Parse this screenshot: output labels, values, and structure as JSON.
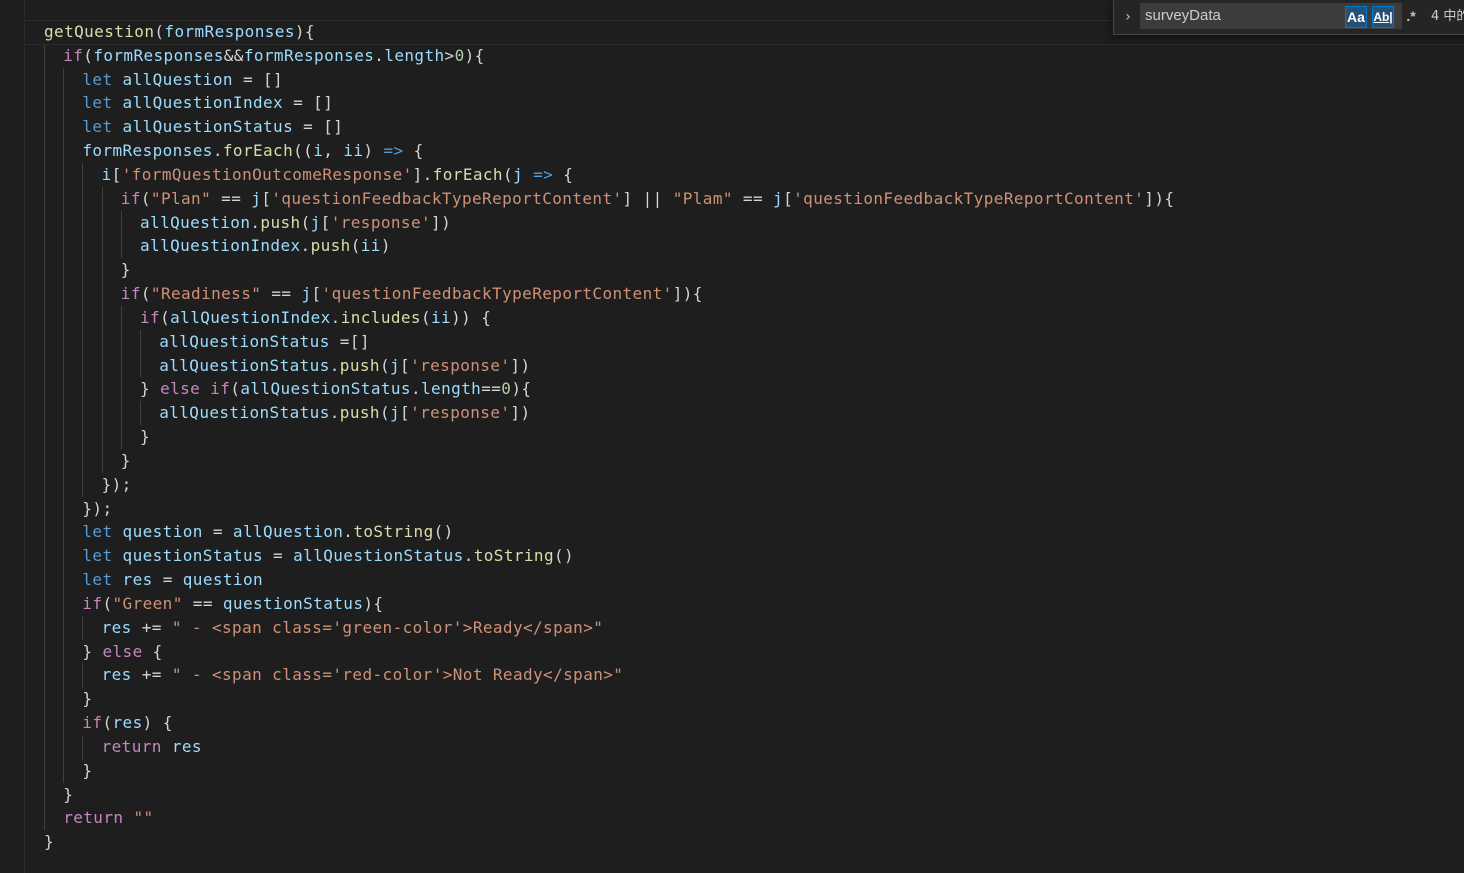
{
  "find_widget": {
    "query": "surveyData",
    "match_case_label": "Aa",
    "whole_word_label": "Ab|",
    "regex_label": ".*",
    "result_text": "4 中的",
    "expand_icon": "chevron-right-icon"
  },
  "colors": {
    "background": "#1e1e1e",
    "function": "#dcdcaa",
    "variable": "#9cdcfe",
    "keyword": "#569cd6",
    "control": "#c586c0",
    "string": "#ce9178",
    "number": "#b5cea8"
  },
  "code_lines": [
    {
      "indent": 0,
      "tokens": [
        [
          "fn",
          "getQuestion"
        ],
        [
          "op",
          "("
        ],
        [
          "var",
          "formResponses"
        ],
        [
          "op",
          "){"
        ]
      ]
    },
    {
      "indent": 1,
      "tokens": [
        [
          "ctl",
          "if"
        ],
        [
          "op",
          "("
        ],
        [
          "var",
          "formResponses"
        ],
        [
          "op",
          "&&"
        ],
        [
          "var",
          "formResponses"
        ],
        [
          "op",
          "."
        ],
        [
          "var",
          "length"
        ],
        [
          "op",
          ">"
        ],
        [
          "num",
          "0"
        ],
        [
          "op",
          "){"
        ]
      ]
    },
    {
      "indent": 2,
      "tokens": [
        [
          "kw",
          "let"
        ],
        [
          "op",
          " "
        ],
        [
          "var",
          "allQuestion"
        ],
        [
          "op",
          " = []"
        ]
      ]
    },
    {
      "indent": 2,
      "tokens": [
        [
          "kw",
          "let"
        ],
        [
          "op",
          " "
        ],
        [
          "var",
          "allQuestionIndex"
        ],
        [
          "op",
          " = []"
        ]
      ]
    },
    {
      "indent": 2,
      "tokens": [
        [
          "kw",
          "let"
        ],
        [
          "op",
          " "
        ],
        [
          "var",
          "allQuestionStatus"
        ],
        [
          "op",
          " = []"
        ]
      ]
    },
    {
      "indent": 2,
      "tokens": [
        [
          "var",
          "formResponses"
        ],
        [
          "op",
          "."
        ],
        [
          "fn",
          "forEach"
        ],
        [
          "op",
          "(("
        ],
        [
          "var",
          "i"
        ],
        [
          "op",
          ", "
        ],
        [
          "var",
          "ii"
        ],
        [
          "op",
          ") "
        ],
        [
          "kw",
          "=>"
        ],
        [
          "op",
          " {"
        ]
      ]
    },
    {
      "indent": 3,
      "tokens": [
        [
          "var",
          "i"
        ],
        [
          "op",
          "["
        ],
        [
          "str",
          "'formQuestionOutcomeResponse'"
        ],
        [
          "op",
          "]."
        ],
        [
          "fn",
          "forEach"
        ],
        [
          "op",
          "("
        ],
        [
          "var",
          "j"
        ],
        [
          "op",
          " "
        ],
        [
          "kw",
          "=>"
        ],
        [
          "op",
          " {"
        ]
      ]
    },
    {
      "indent": 4,
      "tokens": [
        [
          "ctl",
          "if"
        ],
        [
          "op",
          "("
        ],
        [
          "str",
          "\"Plan\""
        ],
        [
          "op",
          " == "
        ],
        [
          "var",
          "j"
        ],
        [
          "op",
          "["
        ],
        [
          "str",
          "'questionFeedbackTypeReportContent'"
        ],
        [
          "op",
          "] || "
        ],
        [
          "str",
          "\"Plam\""
        ],
        [
          "op",
          " == "
        ],
        [
          "var",
          "j"
        ],
        [
          "op",
          "["
        ],
        [
          "str",
          "'questionFeedbackTypeReportContent'"
        ],
        [
          "op",
          "]){"
        ]
      ]
    },
    {
      "indent": 5,
      "tokens": [
        [
          "var",
          "allQuestion"
        ],
        [
          "op",
          "."
        ],
        [
          "fn",
          "push"
        ],
        [
          "op",
          "("
        ],
        [
          "var",
          "j"
        ],
        [
          "op",
          "["
        ],
        [
          "str",
          "'response'"
        ],
        [
          "op",
          "])"
        ]
      ]
    },
    {
      "indent": 5,
      "tokens": [
        [
          "var",
          "allQuestionIndex"
        ],
        [
          "op",
          "."
        ],
        [
          "fn",
          "push"
        ],
        [
          "op",
          "("
        ],
        [
          "var",
          "ii"
        ],
        [
          "op",
          ")"
        ]
      ]
    },
    {
      "indent": 4,
      "tokens": [
        [
          "op",
          "}"
        ]
      ]
    },
    {
      "indent": 4,
      "tokens": [
        [
          "ctl",
          "if"
        ],
        [
          "op",
          "("
        ],
        [
          "str",
          "\"Readiness\""
        ],
        [
          "op",
          " == "
        ],
        [
          "var",
          "j"
        ],
        [
          "op",
          "["
        ],
        [
          "str",
          "'questionFeedbackTypeReportContent'"
        ],
        [
          "op",
          "]){"
        ]
      ]
    },
    {
      "indent": 5,
      "tokens": [
        [
          "ctl",
          "if"
        ],
        [
          "op",
          "("
        ],
        [
          "var",
          "allQuestionIndex"
        ],
        [
          "op",
          "."
        ],
        [
          "fn",
          "includes"
        ],
        [
          "op",
          "("
        ],
        [
          "var",
          "ii"
        ],
        [
          "op",
          ")) {"
        ]
      ]
    },
    {
      "indent": 6,
      "tokens": [
        [
          "var",
          "allQuestionStatus"
        ],
        [
          "op",
          " =[]"
        ]
      ]
    },
    {
      "indent": 6,
      "tokens": [
        [
          "var",
          "allQuestionStatus"
        ],
        [
          "op",
          "."
        ],
        [
          "fn",
          "push"
        ],
        [
          "op",
          "("
        ],
        [
          "var",
          "j"
        ],
        [
          "op",
          "["
        ],
        [
          "str",
          "'response'"
        ],
        [
          "op",
          "])"
        ]
      ]
    },
    {
      "indent": 5,
      "tokens": [
        [
          "op",
          "} "
        ],
        [
          "ctl",
          "else"
        ],
        [
          "op",
          " "
        ],
        [
          "ctl",
          "if"
        ],
        [
          "op",
          "("
        ],
        [
          "var",
          "allQuestionStatus"
        ],
        [
          "op",
          "."
        ],
        [
          "var",
          "length"
        ],
        [
          "op",
          "=="
        ],
        [
          "num",
          "0"
        ],
        [
          "op",
          "){"
        ]
      ]
    },
    {
      "indent": 6,
      "tokens": [
        [
          "var",
          "allQuestionStatus"
        ],
        [
          "op",
          "."
        ],
        [
          "fn",
          "push"
        ],
        [
          "op",
          "("
        ],
        [
          "var",
          "j"
        ],
        [
          "op",
          "["
        ],
        [
          "str",
          "'response'"
        ],
        [
          "op",
          "])"
        ]
      ]
    },
    {
      "indent": 5,
      "tokens": [
        [
          "op",
          "}"
        ]
      ]
    },
    {
      "indent": 4,
      "tokens": [
        [
          "op",
          "}"
        ]
      ]
    },
    {
      "indent": 3,
      "tokens": [
        [
          "op",
          "});"
        ]
      ]
    },
    {
      "indent": 2,
      "tokens": [
        [
          "op",
          "});"
        ]
      ]
    },
    {
      "indent": 2,
      "tokens": [
        [
          "kw",
          "let"
        ],
        [
          "op",
          " "
        ],
        [
          "var",
          "question"
        ],
        [
          "op",
          " = "
        ],
        [
          "var",
          "allQuestion"
        ],
        [
          "op",
          "."
        ],
        [
          "fn",
          "toString"
        ],
        [
          "op",
          "()"
        ]
      ]
    },
    {
      "indent": 2,
      "tokens": [
        [
          "kw",
          "let"
        ],
        [
          "op",
          " "
        ],
        [
          "var",
          "questionStatus"
        ],
        [
          "op",
          " = "
        ],
        [
          "var",
          "allQuestionStatus"
        ],
        [
          "op",
          "."
        ],
        [
          "fn",
          "toString"
        ],
        [
          "op",
          "()"
        ]
      ]
    },
    {
      "indent": 2,
      "tokens": [
        [
          "kw",
          "let"
        ],
        [
          "op",
          " "
        ],
        [
          "var",
          "res"
        ],
        [
          "op",
          " = "
        ],
        [
          "var",
          "question"
        ]
      ]
    },
    {
      "indent": 2,
      "tokens": [
        [
          "ctl",
          "if"
        ],
        [
          "op",
          "("
        ],
        [
          "str",
          "\"Green\""
        ],
        [
          "op",
          " == "
        ],
        [
          "var",
          "questionStatus"
        ],
        [
          "op",
          "){"
        ]
      ]
    },
    {
      "indent": 3,
      "tokens": [
        [
          "var",
          "res"
        ],
        [
          "op",
          " += "
        ],
        [
          "str",
          "\" - <span class='green-color'>Ready</span>\""
        ]
      ]
    },
    {
      "indent": 2,
      "tokens": [
        [
          "op",
          "} "
        ],
        [
          "ctl",
          "else"
        ],
        [
          "op",
          " {"
        ]
      ]
    },
    {
      "indent": 3,
      "tokens": [
        [
          "var",
          "res"
        ],
        [
          "op",
          " += "
        ],
        [
          "str",
          "\" - <span class='red-color'>Not Ready</span>\""
        ]
      ]
    },
    {
      "indent": 2,
      "tokens": [
        [
          "op",
          "}"
        ]
      ]
    },
    {
      "indent": 2,
      "tokens": [
        [
          "ctl",
          "if"
        ],
        [
          "op",
          "("
        ],
        [
          "var",
          "res"
        ],
        [
          "op",
          ") {"
        ]
      ]
    },
    {
      "indent": 3,
      "tokens": [
        [
          "ctl",
          "return"
        ],
        [
          "op",
          " "
        ],
        [
          "var",
          "res"
        ]
      ]
    },
    {
      "indent": 2,
      "tokens": [
        [
          "op",
          "}"
        ]
      ]
    },
    {
      "indent": 1,
      "tokens": [
        [
          "op",
          "}"
        ]
      ]
    },
    {
      "indent": 1,
      "tokens": [
        [
          "ctl",
          "return"
        ],
        [
          "op",
          " "
        ],
        [
          "str",
          "\"\""
        ]
      ]
    },
    {
      "indent": 0,
      "tokens": [
        [
          "op",
          "}"
        ]
      ]
    }
  ]
}
